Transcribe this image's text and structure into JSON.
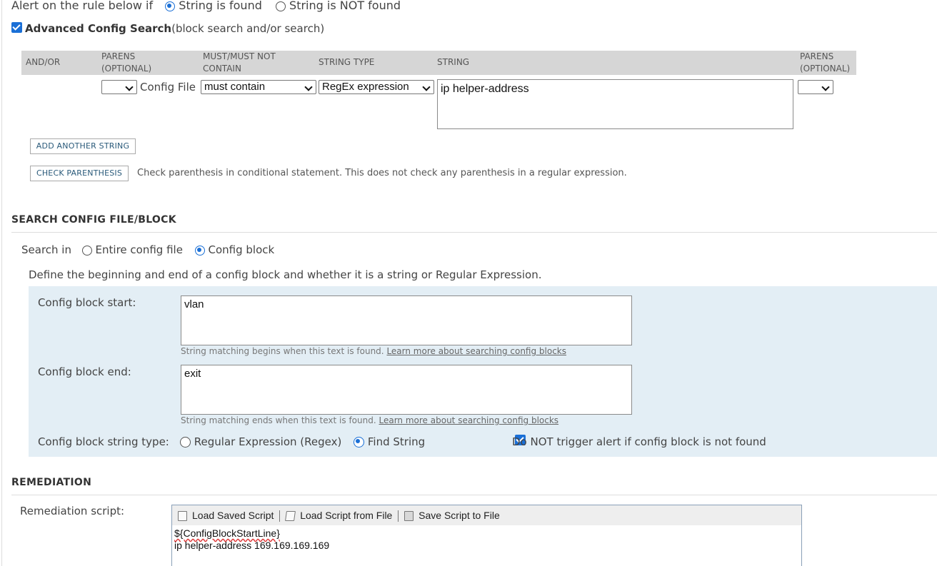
{
  "alert_rule": {
    "label": "Alert on the rule below if",
    "option_found": "String is found",
    "option_not_found": "String is NOT found",
    "selected": "found"
  },
  "advanced": {
    "title": "Advanced Config Search",
    "subtitle": "(block search and/or search)",
    "checked": true
  },
  "table": {
    "headers": {
      "and_or": "AND/OR",
      "parens_open_1": "PARENS",
      "parens_open_2": "(OPTIONAL)",
      "must_1": "MUST/MUST NOT",
      "must_2": "CONTAIN",
      "string_type": "STRING TYPE",
      "string": "STRING",
      "parens_close_1": "PARENS",
      "parens_close_2": "(OPTIONAL)"
    },
    "row": {
      "parens_open_value": "",
      "source_label": "Config File",
      "must_value": "must contain",
      "string_type_value": "RegEx expression",
      "string_value": "ip helper-address",
      "parens_close_value": ""
    }
  },
  "buttons": {
    "add_string": "ADD ANOTHER STRING",
    "check_parens": "CHECK PARENTHESIS",
    "check_parens_hint": "Check parenthesis in conditional statement. This does not check any parenthesis in a regular expression."
  },
  "search_block": {
    "section_title": "SEARCH CONFIG FILE/BLOCK",
    "search_in_label": "Search in",
    "option_entire": "Entire config file",
    "option_block": "Config block",
    "selected": "block",
    "description": "Define the beginning and end of a config block and whether it is a string or Regular Expression.",
    "start_label": "Config block start:",
    "start_value": "vlan",
    "start_hint": "String matching begins when this text is found.",
    "end_label": "Config block end:",
    "end_value": "exit",
    "end_hint": "String matching ends when this text is found.",
    "learn_more": "Learn more about searching config blocks",
    "string_type_label": "Config block string type:",
    "option_regex": "Regular Expression (Regex)",
    "option_find": "Find String",
    "string_type_selected": "find",
    "no_trigger_label": "Do NOT trigger alert if config block is not found",
    "no_trigger_checked": true
  },
  "remediation": {
    "section_title": "REMEDIATION",
    "script_label": "Remediation script:",
    "toolbar": {
      "load_saved": "Load Saved Script",
      "load_file": "Load Script from File",
      "save_file": "Save Script to File"
    },
    "script_line_1": "${ConfigBlockStartLine}",
    "script_line_2": "ip helper-address 169.169.169.169"
  },
  "colors": {
    "accent": "#1a6fd6",
    "table_header_bg": "#d6d6d6",
    "block_panel_bg": "#e3eef5",
    "toolbar_bg": "#eeeeee"
  }
}
